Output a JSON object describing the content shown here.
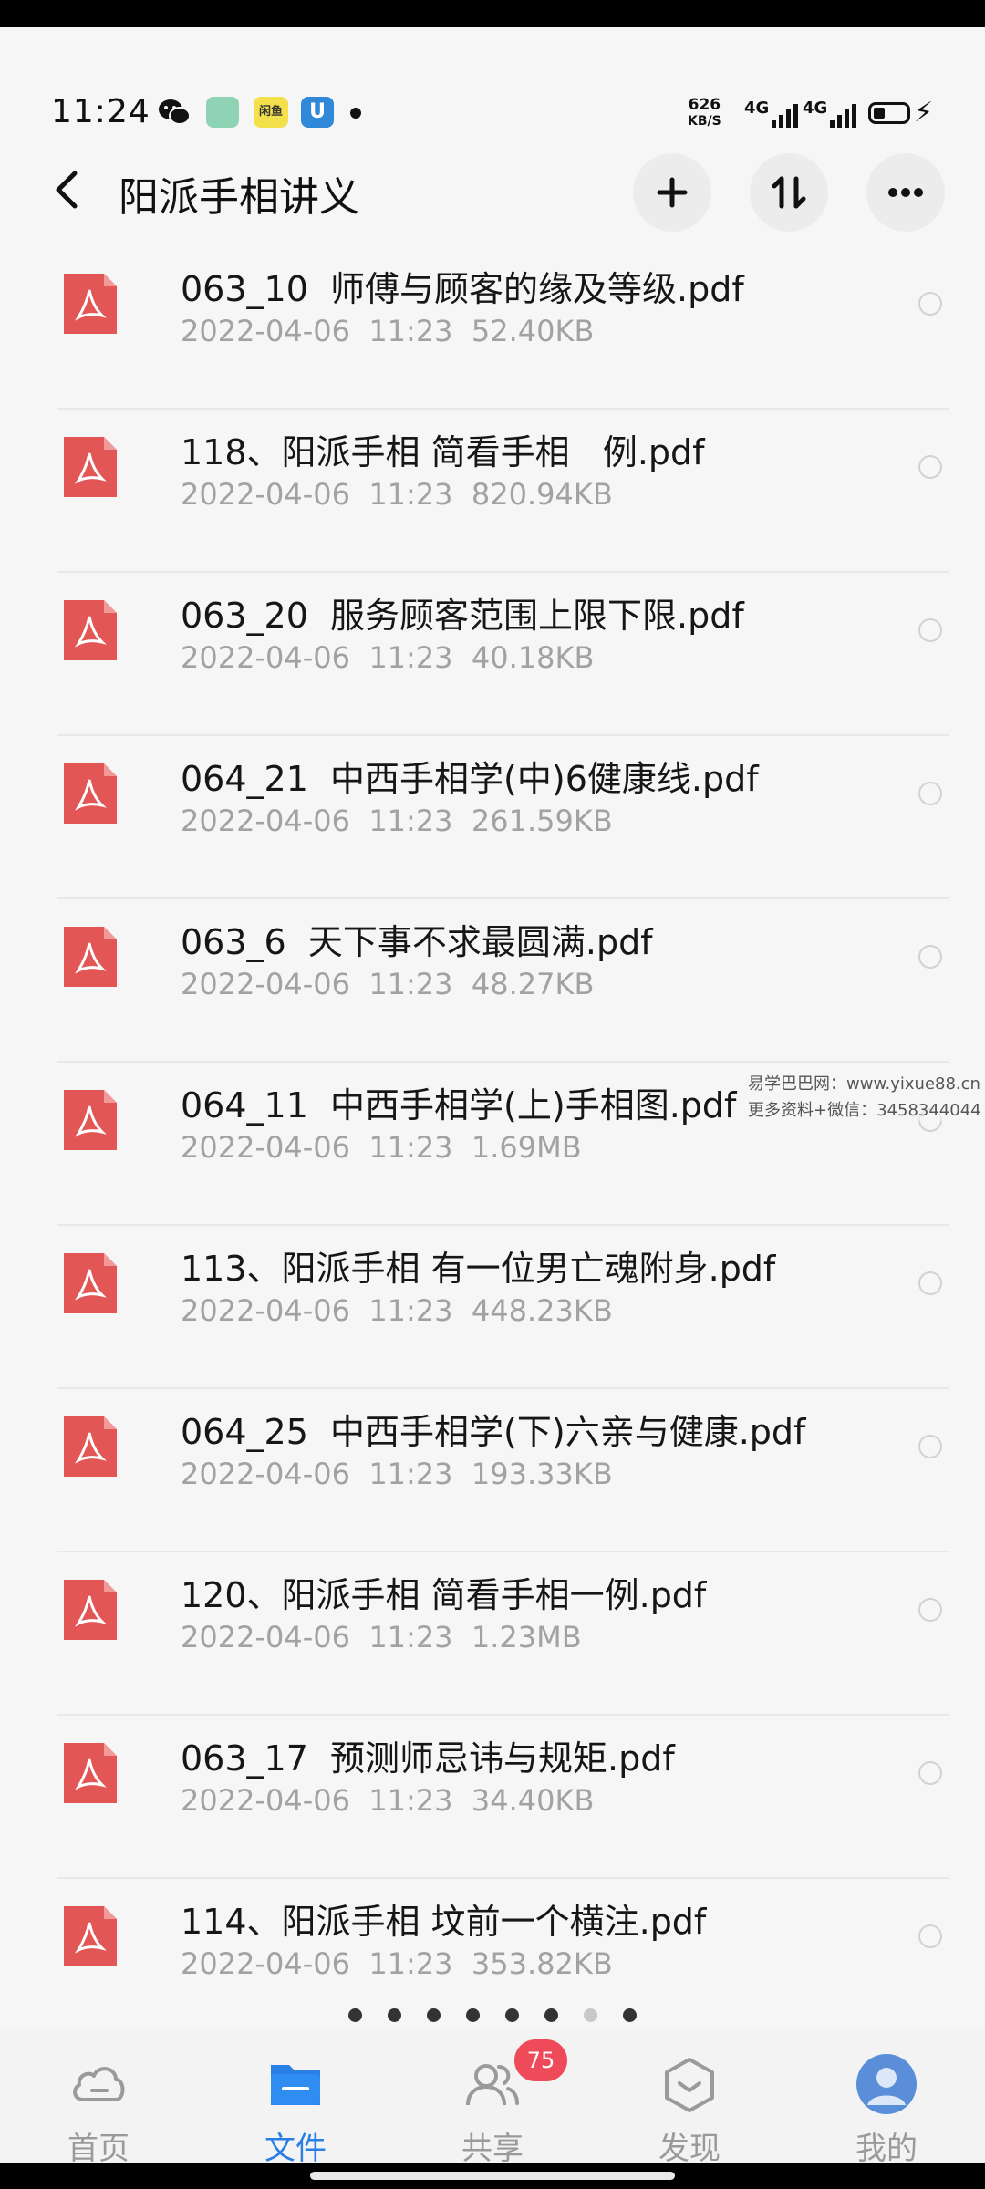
{
  "status_bar": {
    "time": "11:24",
    "app_icon_label": "闲鱼",
    "net_speed_value": "626",
    "net_speed_unit": "KB/S",
    "signal_1": "4G",
    "signal_2": "4G"
  },
  "header": {
    "title": "阳派手相讲义"
  },
  "files": [
    {
      "name": "063_10  师傅与顾客的缘及等级.pdf",
      "date": "2022-04-06",
      "time": "11:23",
      "size": "52.40KB"
    },
    {
      "name": "118、阳派手相 简看手相   例.pdf",
      "date": "2022-04-06",
      "time": "11:23",
      "size": "820.94KB"
    },
    {
      "name": "063_20  服务顾客范围上限下限.pdf",
      "date": "2022-04-06",
      "time": "11:23",
      "size": "40.18KB"
    },
    {
      "name": "064_21  中西手相学(中)6健康线.pdf",
      "date": "2022-04-06",
      "time": "11:23",
      "size": "261.59KB"
    },
    {
      "name": "063_6  天下事不求最圆满.pdf",
      "date": "2022-04-06",
      "time": "11:23",
      "size": "48.27KB"
    },
    {
      "name": "064_11  中西手相学(上)手相图.pdf",
      "date": "2022-04-06",
      "time": "11:23",
      "size": "1.69MB"
    },
    {
      "name": "113、阳派手相 有一位男亡魂附身.pdf",
      "date": "2022-04-06",
      "time": "11:23",
      "size": "448.23KB"
    },
    {
      "name": "064_25  中西手相学(下)六亲与健康.pdf",
      "date": "2022-04-06",
      "time": "11:23",
      "size": "193.33KB"
    },
    {
      "name": "120、阳派手相 简看手相一例.pdf",
      "date": "2022-04-06",
      "time": "11:23",
      "size": "1.23MB"
    },
    {
      "name": "063_17  预测师忌讳与规矩.pdf",
      "date": "2022-04-06",
      "time": "11:23",
      "size": "34.40KB"
    },
    {
      "name": "114、阳派手相 坟前一个横注.pdf",
      "date": "2022-04-06",
      "time": "11:23",
      "size": "353.82KB"
    }
  ],
  "watermark": {
    "line1": "易学巴巴网：www.yixue88.cn",
    "line2": "更多资料+微信：3458344044"
  },
  "nav": {
    "tabs": [
      {
        "label": "首页",
        "icon": "cloud-home-icon",
        "active": false
      },
      {
        "label": "文件",
        "icon": "folder-icon",
        "active": true
      },
      {
        "label": "共享",
        "icon": "people-share-icon",
        "active": false
      },
      {
        "label": "发现",
        "icon": "discover-box-icon",
        "active": false
      },
      {
        "label": "我的",
        "icon": "avatar-icon",
        "active": false
      }
    ],
    "share_badge": "75"
  },
  "colors": {
    "accent": "#2a7fe4",
    "pdf_red": "#e25656",
    "badge_red": "#ee4a5a"
  }
}
